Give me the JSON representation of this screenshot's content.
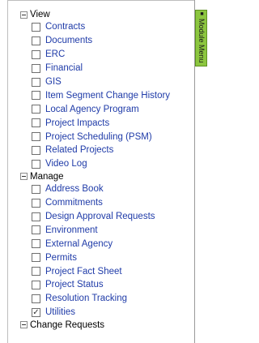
{
  "side_tab": {
    "label": "Module Menu",
    "icon": "arrow-icon"
  },
  "groups": [
    {
      "title": "View",
      "items": [
        {
          "label": "Contracts",
          "checked": false
        },
        {
          "label": "Documents",
          "checked": false
        },
        {
          "label": "ERC",
          "checked": false
        },
        {
          "label": "Financial",
          "checked": false
        },
        {
          "label": "GIS",
          "checked": false
        },
        {
          "label": "Item Segment Change History",
          "checked": false
        },
        {
          "label": "Local Agency Program",
          "checked": false
        },
        {
          "label": "Project Impacts",
          "checked": false
        },
        {
          "label": "Project Scheduling (PSM)",
          "checked": false
        },
        {
          "label": "Related Projects",
          "checked": false
        },
        {
          "label": "Video Log",
          "checked": false
        }
      ]
    },
    {
      "title": "Manage",
      "items": [
        {
          "label": "Address Book",
          "checked": false
        },
        {
          "label": "Commitments",
          "checked": false
        },
        {
          "label": "Design Approval Requests",
          "checked": false
        },
        {
          "label": "Environment",
          "checked": false
        },
        {
          "label": "External Agency",
          "checked": false
        },
        {
          "label": "Permits",
          "checked": false
        },
        {
          "label": "Project Fact Sheet",
          "checked": false
        },
        {
          "label": "Project Status",
          "checked": false
        },
        {
          "label": "Resolution Tracking",
          "checked": false
        },
        {
          "label": "Utilities",
          "checked": true
        }
      ]
    },
    {
      "title": "Change Requests",
      "items": []
    }
  ],
  "colors": {
    "link": "#1f3ba8",
    "tab": "#8cc63f"
  }
}
